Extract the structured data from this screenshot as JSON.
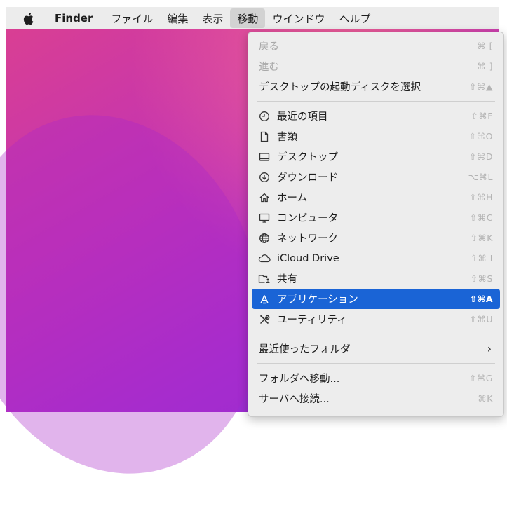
{
  "menubar": {
    "app": "Finder",
    "items": [
      "ファイル",
      "編集",
      "表示",
      "移動",
      "ウインドウ",
      "ヘルプ"
    ],
    "active_index": 3
  },
  "menu": {
    "nav": [
      {
        "label": "戻る",
        "shortcut": "⌘ [",
        "disabled": true
      },
      {
        "label": "進む",
        "shortcut": "⌘ ]",
        "disabled": true
      },
      {
        "label": "デスクトップの起動ディスクを選択",
        "shortcut": "⇧⌘▲",
        "disabled": false
      }
    ],
    "places": [
      {
        "label": "最近の項目",
        "shortcut": "⇧⌘F",
        "icon": "clock-icon"
      },
      {
        "label": "書類",
        "shortcut": "⇧⌘O",
        "icon": "document-icon"
      },
      {
        "label": "デスクトップ",
        "shortcut": "⇧⌘D",
        "icon": "desktop-icon"
      },
      {
        "label": "ダウンロード",
        "shortcut": "⌥⌘L",
        "icon": "download-icon"
      },
      {
        "label": "ホーム",
        "shortcut": "⇧⌘H",
        "icon": "home-icon"
      },
      {
        "label": "コンピュータ",
        "shortcut": "⇧⌘C",
        "icon": "computer-icon"
      },
      {
        "label": "ネットワーク",
        "shortcut": "⇧⌘K",
        "icon": "network-icon"
      },
      {
        "label": "iCloud Drive",
        "shortcut": "⇧⌘ I",
        "icon": "cloud-icon"
      },
      {
        "label": "共有",
        "shortcut": "⇧⌘S",
        "icon": "shared-folder-icon"
      },
      {
        "label": "アプリケーション",
        "shortcut": "⇧⌘A",
        "icon": "applications-icon",
        "selected": true
      },
      {
        "label": "ユーティリティ",
        "shortcut": "⇧⌘U",
        "icon": "utilities-icon"
      }
    ],
    "recent_folders": {
      "label": "最近使ったフォルダ",
      "chevron": "›"
    },
    "go_to_folder": {
      "label": "フォルダへ移動...",
      "shortcut": "⇧⌘G"
    },
    "connect_server": {
      "label": "サーバへ接続...",
      "shortcut": "⌘K"
    }
  },
  "colors": {
    "selection": "#1a64d6",
    "menu_bg": "#ededed",
    "menubar_bg": "#ececec"
  }
}
